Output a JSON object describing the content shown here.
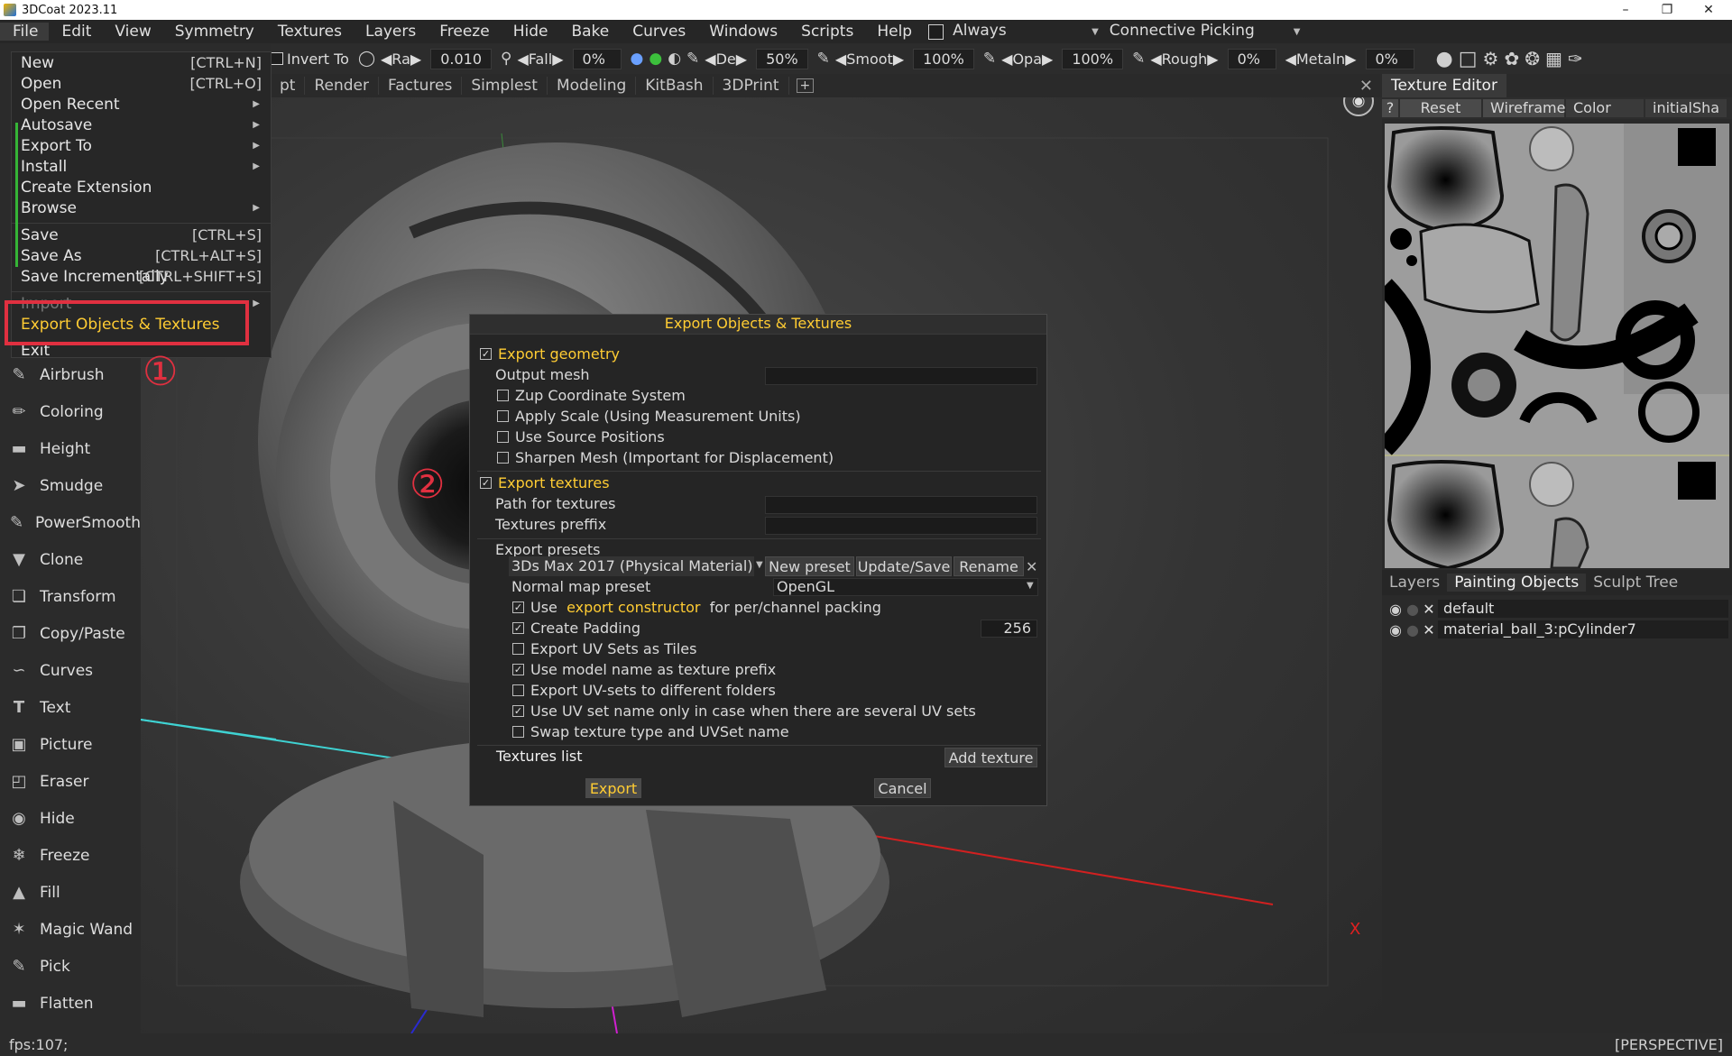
{
  "window": {
    "title": "3DCoat 2023.11",
    "controls": [
      "–",
      "❐",
      "✕"
    ]
  },
  "menubar": {
    "items": [
      "File",
      "Edit",
      "View",
      "Symmetry",
      "Textures",
      "Layers",
      "Freeze",
      "Hide",
      "Bake",
      "Curves",
      "Windows",
      "Scripts",
      "Help"
    ],
    "always_label": "Always",
    "picking_label": "Connective  Picking"
  },
  "toolbar": {
    "invert_label": "Invert  To",
    "radius_label": "Ra",
    "radius_value": "0.010",
    "falloff_label": "Fall",
    "falloff_value": "0%",
    "depth_label": "De",
    "depth_value": "50%",
    "smooth_label": "Smoot",
    "smooth_value": "100%",
    "opacity_label": "Opa",
    "opacity_value": "100%",
    "roughness_label": "Rough",
    "roughness_value": "0%",
    "metalness_label": "Metaln",
    "metalness_value": "0%"
  },
  "workspace_tabs": [
    "pt",
    "Render",
    "Factures",
    "Simplest",
    "Modeling",
    "KitBash",
    "3DPrint"
  ],
  "file_menu": {
    "items": [
      {
        "label": "New",
        "shortcut": "[CTRL+N]"
      },
      {
        "label": "Open",
        "shortcut": "[CTRL+O]"
      },
      {
        "label": "Open  Recent",
        "submenu": true
      },
      {
        "label": "Autosave",
        "submenu": true
      },
      {
        "label": "Export  To",
        "submenu": true
      },
      {
        "label": "Install",
        "submenu": true
      },
      {
        "label": "Create  Extension"
      },
      {
        "label": "Browse",
        "submenu": true
      },
      {
        "label": "Save",
        "shortcut": "[CTRL+S]"
      },
      {
        "label": "Save  As",
        "shortcut": "[CTRL+ALT+S]"
      },
      {
        "label": "Save  Incrementally",
        "shortcut": "[CTRL+SHIFT+S]"
      },
      {
        "label": "Import",
        "submenu": true
      },
      {
        "label": "Export  Objects  &  Textures"
      },
      {
        "label": "Exit"
      }
    ]
  },
  "annotations": {
    "step1": "①",
    "step2": "②"
  },
  "tools": [
    "Airbrush",
    "Coloring",
    "Height",
    "Smudge",
    "PowerSmooth",
    "Clone",
    "Transform",
    "Copy/Paste",
    "Curves",
    "Text",
    "Picture",
    "Eraser",
    "Hide",
    "Freeze",
    "Fill",
    "Magic  Wand",
    "Pick",
    "Flatten"
  ],
  "dialog": {
    "title": "Export  Objects  &  Textures",
    "export_geometry": {
      "label": "Export  geometry",
      "checked": true
    },
    "output_mesh_label": "Output  mesh",
    "geometry_options": [
      {
        "label": "Zup  Coordinate  System",
        "checked": false
      },
      {
        "label": "Apply  Scale  (Using  Measurement  Units)",
        "checked": false
      },
      {
        "label": "Use  Source  Positions",
        "checked": false
      },
      {
        "label": "Sharpen  Mesh  (Important  for  Displacement)",
        "checked": false
      }
    ],
    "export_textures": {
      "label": "Export  textures",
      "checked": true
    },
    "path_label": "Path  for  textures",
    "prefix_label": "Textures  preffix",
    "presets_label": "Export  presets",
    "preset_value": "3Ds  Max  2017  (Physical  Material)",
    "new_preset": "New  preset",
    "update_save": "Update/Save",
    "rename": "Rename",
    "normal_map_label": "Normal  map  preset",
    "normal_map_value": "OpenGL",
    "constructor_prefix": "Use",
    "constructor_link": "export  constructor",
    "constructor_suffix": "for  per/channel  packing",
    "padding_label": "Create  Padding",
    "padding_value": "256",
    "options": [
      {
        "label": "Export  UV  Sets  as  Tiles",
        "checked": false
      },
      {
        "label": "Use  model  name  as  texture  prefix",
        "checked": true
      },
      {
        "label": "Export  UV-sets  to  different  folders",
        "checked": false
      },
      {
        "label": "Use  UV  set  name  only  in  case  when  there  are  several  UV  sets",
        "checked": true
      },
      {
        "label": "Swap  texture  type  and  UVSet  name",
        "checked": false
      }
    ],
    "textures_list_label": "Textures  list",
    "add_texture": "Add  texture",
    "export_button": "Export",
    "cancel_button": "Cancel"
  },
  "texture_editor": {
    "title": "Texture  Editor",
    "help": "?",
    "reset": "Reset",
    "wireframe": "Wireframe",
    "color_mode": "Color",
    "shader": "initialSha"
  },
  "right_tabs": [
    "Layers",
    "Painting  Objects",
    "Sculpt  Tree"
  ],
  "objects": [
    "default",
    "material_ball_3:pCylinder7"
  ],
  "status": {
    "fps": "fps:107;",
    "view_mode": "[PERSPECTIVE]",
    "axis_label": "X"
  },
  "colors": {
    "accent": "#ffcc33",
    "annotation": "#e03040",
    "checked_green": "#35b536"
  }
}
